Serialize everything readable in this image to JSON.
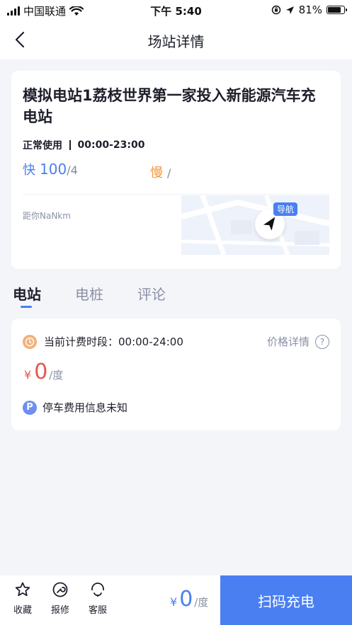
{
  "status_bar": {
    "carrier": "中国联通",
    "time": "下午 5:40",
    "battery_percent": "81%",
    "battery_level": 0.81
  },
  "nav": {
    "title": "场站详情"
  },
  "station": {
    "name": "模拟电站1荔枝世界第一家投入新能源汽车充电站",
    "status": "正常使用",
    "hours": "00:00-23:00",
    "fast_label": "快",
    "fast_available": "100",
    "fast_total": "/4",
    "slow_label": "慢",
    "slow_total": "/",
    "distance": "距你NaNkm",
    "nav_label": "导航"
  },
  "tabs": [
    {
      "label": "电站",
      "active": true
    },
    {
      "label": "电桩",
      "active": false
    },
    {
      "label": "评论",
      "active": false
    }
  ],
  "pricing": {
    "period_label": "当前计费时段：00:00-24:00",
    "detail_label": "价格详情",
    "currency": "¥",
    "price": "0",
    "unit": "/度",
    "parking_text": "停车费用信息未知"
  },
  "bottom_bar": {
    "favorite_label": "收藏",
    "repair_label": "报修",
    "service_label": "客服",
    "currency": "¥",
    "price": "0",
    "unit": "/度",
    "scan_label": "扫码充电"
  },
  "colors": {
    "accent": "#4a7ff2",
    "price_red": "#e85650",
    "slow_orange": "#f0963c"
  }
}
